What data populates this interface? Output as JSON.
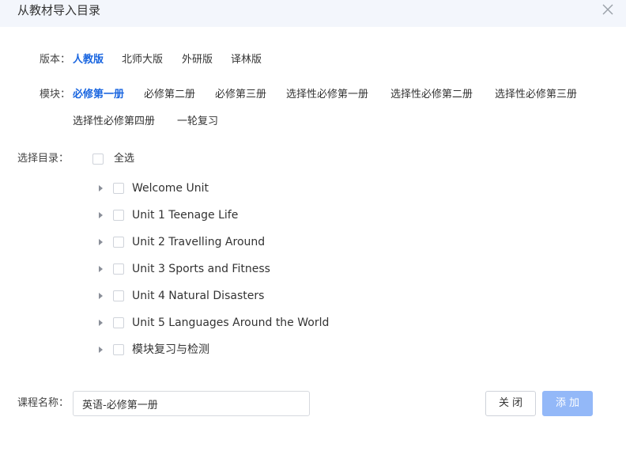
{
  "dialog": {
    "title": "从教材导入目录",
    "close_icon": "close-icon"
  },
  "version": {
    "label": "版本：",
    "options": [
      "人教版",
      "北师大版",
      "外研版",
      "译林版"
    ],
    "selected": "人教版"
  },
  "module": {
    "label": "模块：",
    "options": [
      "必修第一册",
      "必修第二册",
      "必修第三册",
      "选择性必修第一册",
      "选择性必修第二册",
      "选择性必修第三册",
      "选择性必修第四册",
      "一轮复习"
    ],
    "selected": "必修第一册"
  },
  "catalog": {
    "label": "选择目录：",
    "select_all": "全选",
    "items": [
      "Welcome Unit",
      "Unit 1 Teenage Life",
      "Unit 2 Travelling Around",
      "Unit 3 Sports and Fitness",
      "Unit 4 Natural Disasters",
      "Unit 5 Languages Around the World",
      "模块复习与检测"
    ]
  },
  "course": {
    "label": "课程名称：",
    "value": "英语-必修第一册"
  },
  "buttons": {
    "close": "关闭",
    "add": "添加"
  },
  "colors": {
    "accent": "#1a66e0",
    "header_bg": "#f3f6fc",
    "add_button_disabled": "#93b8f8"
  }
}
